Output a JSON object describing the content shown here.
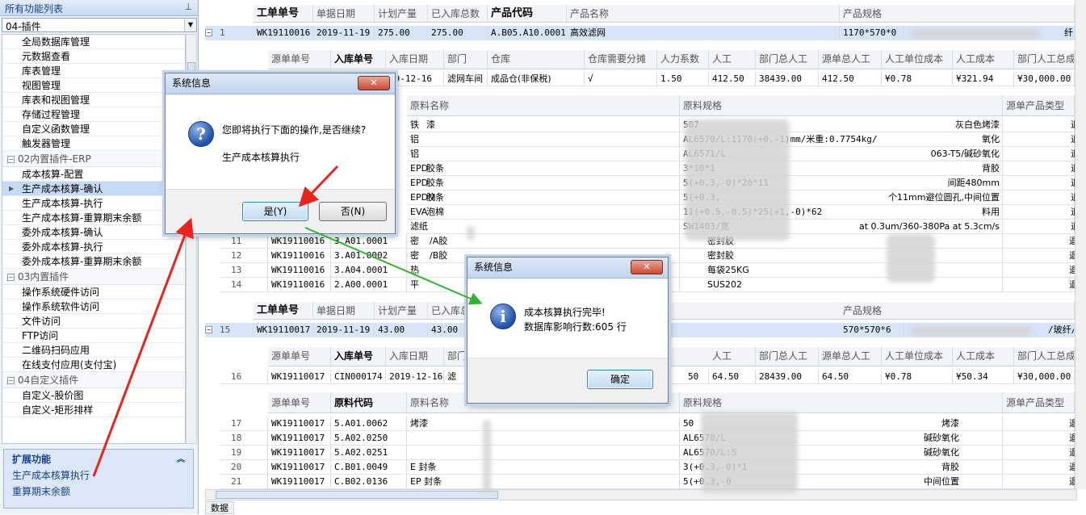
{
  "left_panel": {
    "title": "所有功能列表",
    "pin_icon": "pin-icon",
    "combo_value": "04-插件",
    "items_plugin": [
      "全局数据库管理",
      "元数据查看",
      "库表管理",
      "视图管理",
      "库表和视图管理",
      "存储过程管理",
      "自定义函数管理",
      "触发器管理"
    ],
    "group_erp": "02内置插件-ERP",
    "items_erp": [
      "成本核算-配置",
      "生产成本核算-确认",
      "生产成本核算-执行",
      "生产成本核算-重算期末余额",
      "委外成本核算-确认",
      "委外成本核算-执行",
      "委外成本核算-重算期末余额"
    ],
    "group_builtin": "03内置插件",
    "items_builtin": [
      "操作系统硬件访问",
      "操作系统软件访问",
      "文件访问",
      "FTP访问",
      "二维码扫码应用",
      "在线支付应用(支付宝)"
    ],
    "group_custom": "04自定义插件",
    "items_custom": [
      "自定义-股价图",
      "自定义-矩形排样"
    ],
    "ext_title": "扩展功能",
    "ext_links": [
      "生产成本核算执行",
      "重算期末余额"
    ]
  },
  "grid": {
    "master_headers": [
      "工单单号",
      "单据日期",
      "计划产量",
      "已入库总数",
      "产品代码",
      "产品名称",
      "产品规格"
    ],
    "master1": {
      "rn": "1",
      "order": "WK19110016",
      "date": "2019-11-19",
      "plan": "275.00",
      "stored": "275.00",
      "code": "A.B05.A10.0001",
      "name": "高效滤网",
      "spec": "1170*570*0",
      "spec_tail": "纤"
    },
    "detail_headers": [
      "源单单号",
      "入库单号",
      "入库日期",
      "部门",
      "仓库",
      "仓库需要分摊",
      "人力系数",
      "人工",
      "部门总人工",
      "源单总人工",
      "人工单位成本",
      "人工成本",
      "部门人工总成本"
    ],
    "detail1": {
      "date": "19-12-16",
      "dept": "滤网车间",
      "wh": "成品仓(非保税)",
      "share": "√",
      "coef": "1.50",
      "labor": "412.50",
      "dept_total": "38439.00",
      "src_total": "412.50",
      "unit": "¥0.78",
      "cost": "¥321.94",
      "dept_cost": "¥30,000.00"
    },
    "mat_headers": [
      "原料名称",
      "原料规格",
      "源单产品类型"
    ],
    "mat_rows": [
      {
        "name": "铁",
        "name2": "漆",
        "spec": "507",
        "spec2": "灰白色烤漆",
        "t": "退"
      },
      {
        "name": "铝",
        "name2": "",
        "spec": "AL6570/L:1170(+0.-1)mm/米重:0.7754kg/",
        "spec2": "氧化",
        "t": "退"
      },
      {
        "name": "铝",
        "name2": "",
        "spec": "AL6571/L",
        "spec2": "063-T5/碱砂氧化",
        "t": "退"
      },
      {
        "name": "EPD",
        "name2": "胶条",
        "spec": "3*10*1",
        "spec2": "背胶",
        "t": "退"
      },
      {
        "name": "EPD",
        "name2": "胶条",
        "spec": "5(+0.3,-0)*20*11",
        "spec2": "间距480mm",
        "t": "退"
      },
      {
        "name": "EPDM",
        "name2": "胶条",
        "spec": "5(+0.3,",
        "spec2": "个11mm避位圆孔,中间位置",
        "t": "退"
      },
      {
        "name": "EVA",
        "name2": "泡棉",
        "spec": "11(+0.5,-0.5)*25(+1,-0)*62",
        "spec2": "料用",
        "t": "退"
      },
      {
        "name": "滤纸",
        "name2": "",
        "spec": "SW1403/宽",
        "spec2": "at 0.3um/360-380Pa at 5.3cm/s",
        "t": "退"
      }
    ],
    "mat_rows2": [
      {
        "rn": "11",
        "order": "WK19110016",
        "code": "3.A01.0001",
        "name": "密",
        "name2": "/A胶",
        "spec": "",
        "spec2": "密封胶",
        "t": "退"
      },
      {
        "rn": "12",
        "order": "WK19110016",
        "code": "3.A01.0002",
        "name": "密",
        "name2": "/B胶",
        "spec": "",
        "spec2": "密封胶",
        "t": "退"
      },
      {
        "rn": "13",
        "order": "WK19110016",
        "code": "3.A04.0001",
        "name": "热",
        "name2": "",
        "spec": "",
        "spec2": "每袋25KG",
        "t": "退"
      },
      {
        "rn": "14",
        "order": "WK19110016",
        "code": "2.A00.0001",
        "name": "平",
        "name2": "",
        "spec": "",
        "spec2": "SUS202",
        "t": "退"
      }
    ],
    "master2": {
      "rn": "15",
      "order": "WK19110017",
      "date": "2019-11-19",
      "plan": "43.00",
      "stored": "43.00",
      "spec": "570*570*6",
      "spec_tail": "/玻纤/"
    },
    "detail2": {
      "rn": "16",
      "order": "WK19110017",
      "in_no": "CIN000174",
      "date": "2019-12-16",
      "dept": "滤",
      "coef": "50",
      "labor": "64.50",
      "dept_total": "28439.00",
      "src_total": "64.50",
      "unit": "¥0.78",
      "cost": "¥50.34",
      "dept_cost": "¥30,000.00"
    },
    "mat2_headers": [
      "源单单号",
      "原料代码",
      "原料名称",
      "原料规格",
      "源单产品类型"
    ],
    "mat2_rows": [
      {
        "rn": "17",
        "order": "WK19110017",
        "code": "5.A01.0062",
        "name": "烤漆",
        "spec": "50",
        "spec2": "烤漆",
        "t": "退"
      },
      {
        "rn": "18",
        "order": "WK19110017",
        "code": "5.A02.0250",
        "name": "",
        "spec": "AL6570/L",
        "spec2": "碱砂氧化",
        "t": "退"
      },
      {
        "rn": "19",
        "order": "WK19110017",
        "code": "5.A02.0251",
        "name": "",
        "spec": "AL6570/L:5",
        "spec2": "碱砂氧化",
        "t": "退"
      },
      {
        "rn": "20",
        "order": "WK19110017",
        "code": "C.B01.0049",
        "name": "E 封条",
        "spec": "3(+0.3,-0)*1",
        "spec2": "背胶",
        "t": "退"
      },
      {
        "rn": "21",
        "order": "WK19110017",
        "code": "C.B02.0136",
        "name": "EP 封条",
        "spec": "5(+0.3,-0",
        "spec2": "中间位置",
        "t": "退"
      }
    ],
    "bottom_tab": "数据"
  },
  "dialog_confirm": {
    "title": "系统信息",
    "question": "您即将执行下面的操作,是否继续?",
    "operation": "生产成本核算执行",
    "yes": "是(Y)",
    "no": "否(N)",
    "icon": "question-icon"
  },
  "dialog_done": {
    "title": "系统信息",
    "line1": "成本核算执行完毕!",
    "line2": "数据库影响行数:605 行",
    "ok": "确定",
    "icon": "info-icon"
  },
  "colors": {
    "accent": "#15428b",
    "selection": "#c5daf5",
    "arrow_red": "#e8251c",
    "arrow_green": "#2fb52f"
  }
}
